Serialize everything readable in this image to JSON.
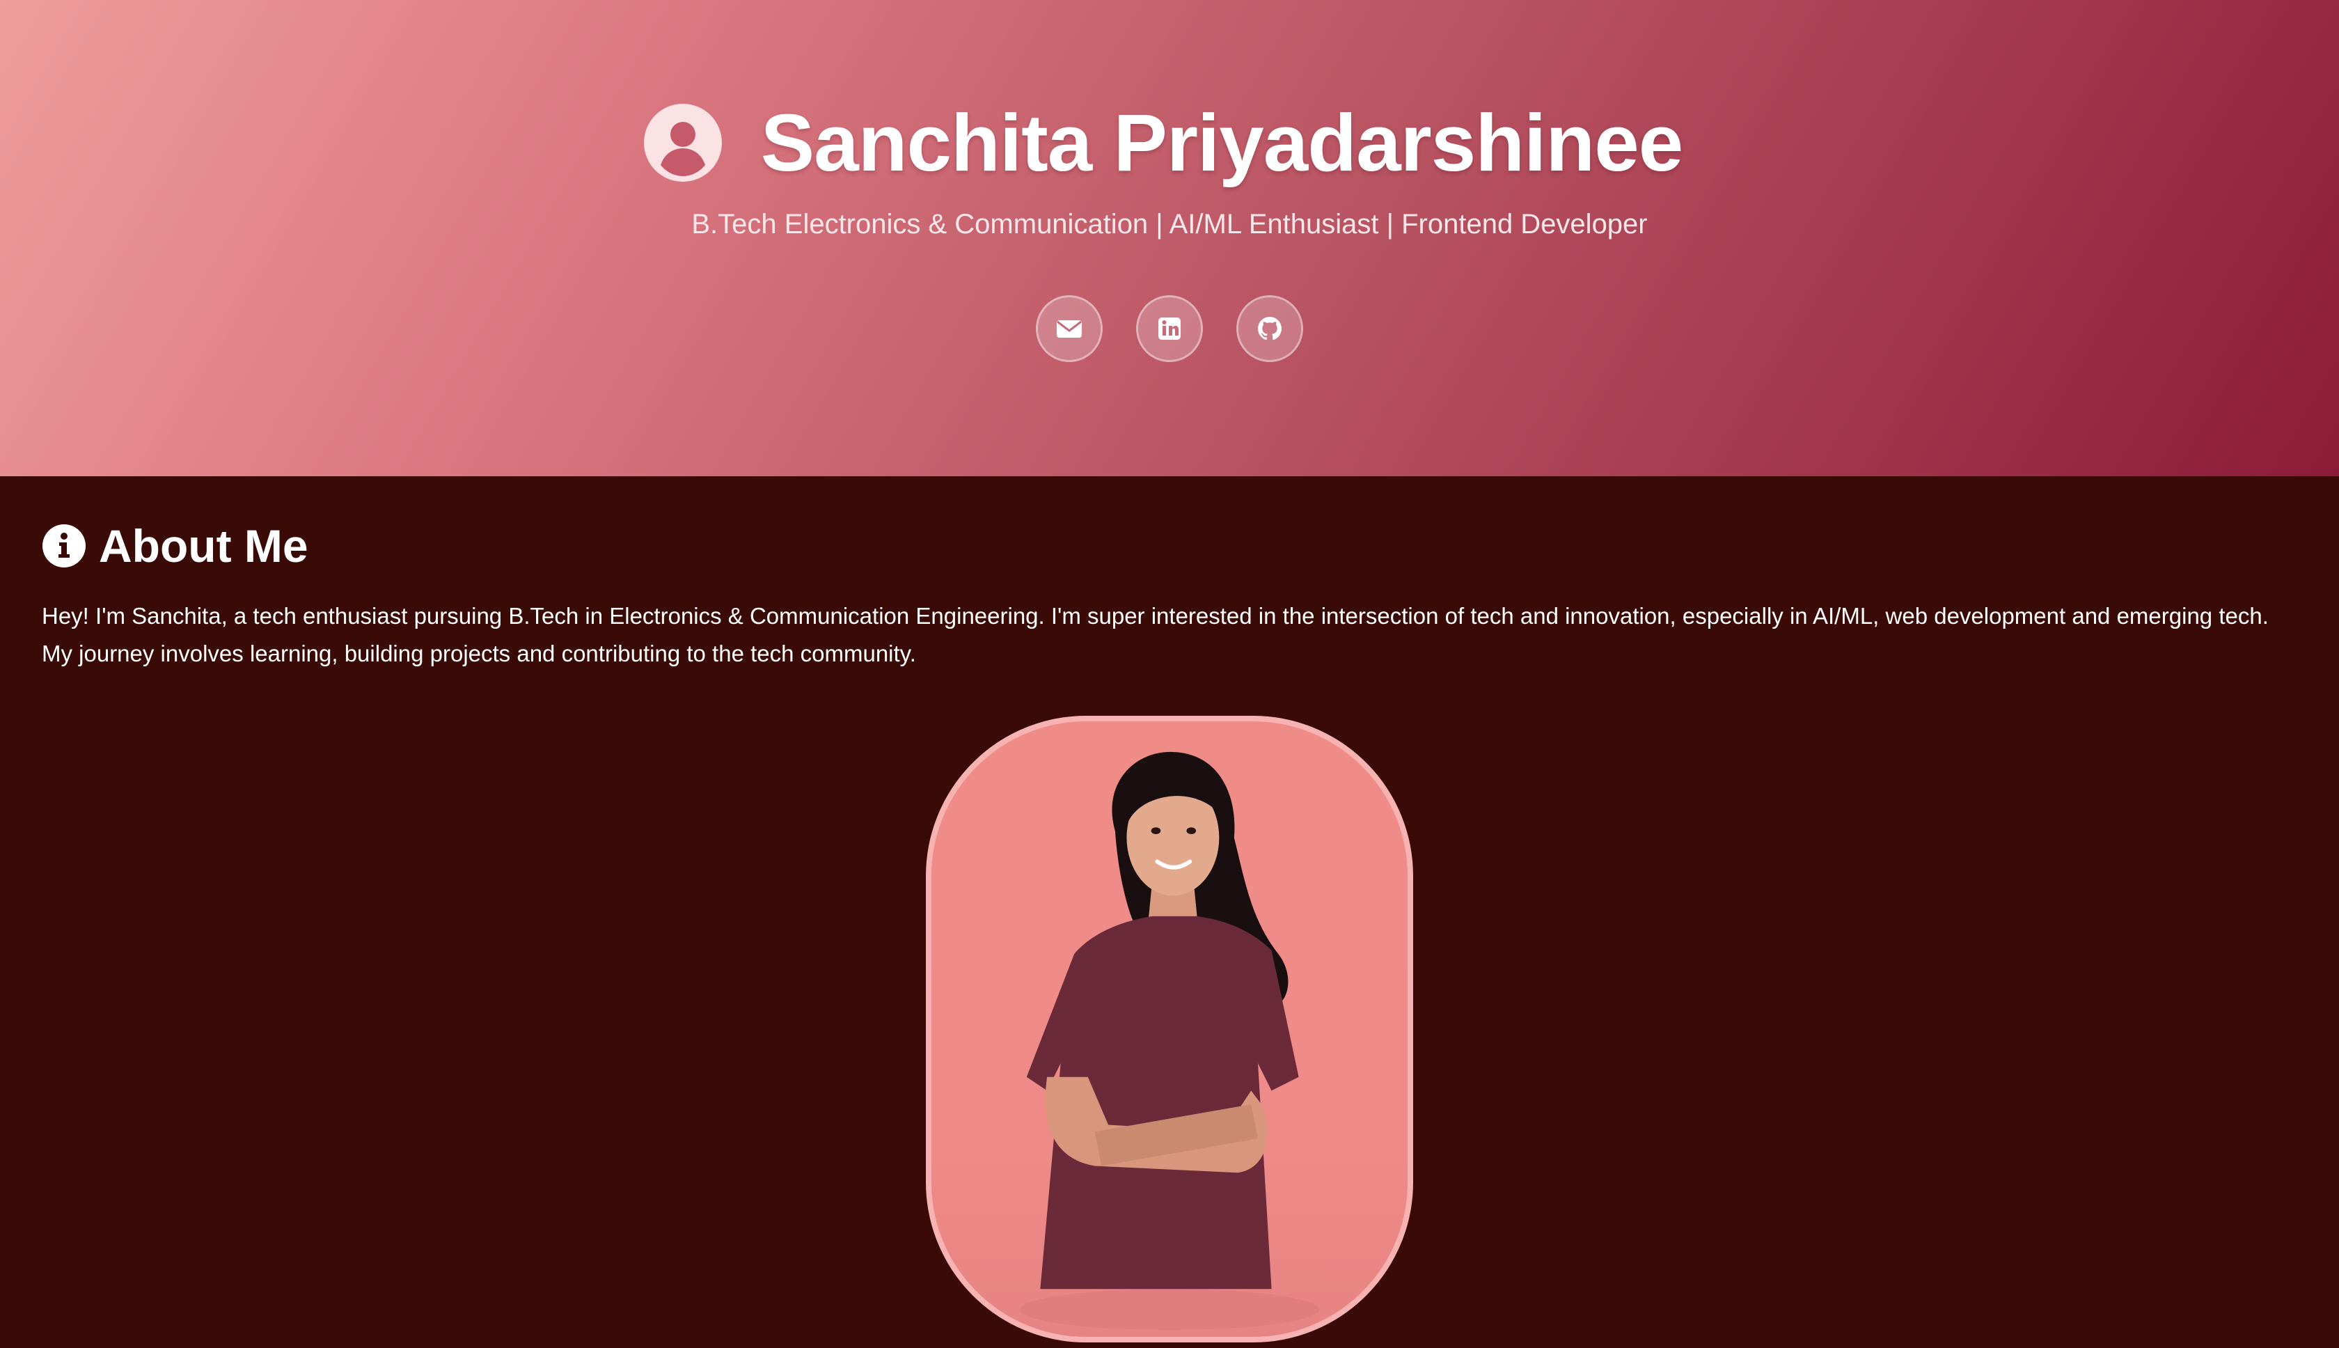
{
  "hero": {
    "name": "Sanchita Priyadarshinee",
    "subtitle": "B.Tech Electronics & Communication | AI/ML Enthusiast | Frontend Developer",
    "profile_icon": "user-circle-icon",
    "socials": [
      {
        "name": "email",
        "icon": "envelope-icon"
      },
      {
        "name": "linkedin",
        "icon": "linkedin-icon"
      },
      {
        "name": "github",
        "icon": "github-icon"
      }
    ]
  },
  "about": {
    "icon": "info-circle-icon",
    "heading": "About Me",
    "text": "Hey! I'm Sanchita, a tech enthusiast pursuing B.Tech in Electronics & Communication Engineering. I'm super interested in the intersection of tech and innovation, especially in AI/ML, web development and emerging tech. My journey involves learning, building projects and contributing to the tech community."
  },
  "colors": {
    "hero_gradient_start": "#f09d9b",
    "hero_gradient_end": "#8c1b38",
    "page_background": "#3a0a07",
    "portrait_background": "#f08c88",
    "text": "#ffffff"
  }
}
